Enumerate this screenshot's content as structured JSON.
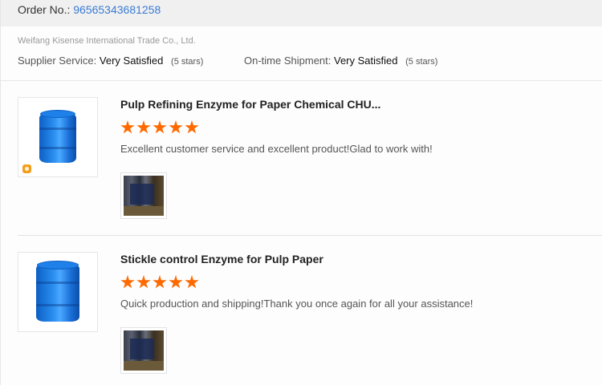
{
  "order": {
    "label": "Order No.:",
    "number": "96565343681258"
  },
  "supplier": {
    "name": "Weifang Kisense International Trade Co., Ltd.",
    "service_label": "Supplier Service:",
    "service_value": "Very Satisfied",
    "service_stars": "(5 stars)",
    "shipment_label": "On-time Shipment:",
    "shipment_value": "Very Satisfied",
    "shipment_stars": "(5 stars)"
  },
  "reviews": [
    {
      "title": "Pulp Refining Enzyme for Paper Chemical CHU...",
      "rating": 5,
      "text": "Excellent customer service and excellent product!Glad to work with!",
      "has_badge": true
    },
    {
      "title": "Stickle control Enzyme for Pulp Paper",
      "rating": 5,
      "text": "Quick production and shipping!Thank you once again for all your assistance!",
      "has_badge": false
    }
  ],
  "colors": {
    "accent_link": "#3a7bd5",
    "star": "#ff6a00",
    "product_blue": "#1e80e8"
  }
}
